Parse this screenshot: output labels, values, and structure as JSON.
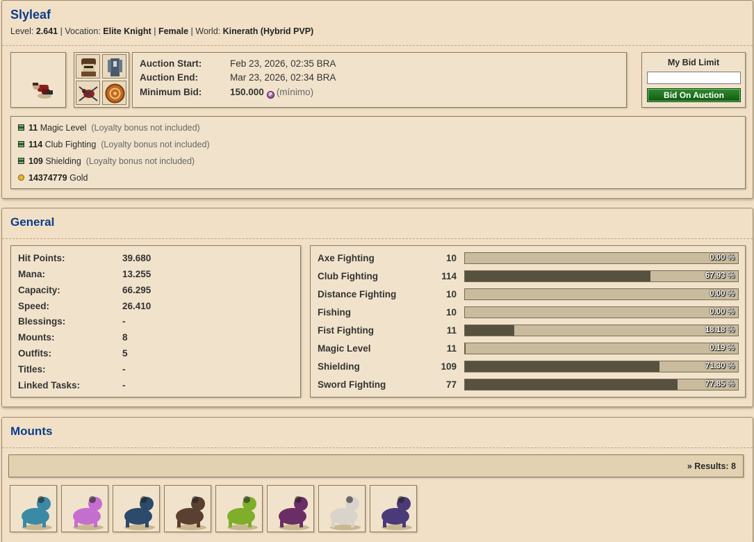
{
  "character": {
    "name": "Slyleaf",
    "level_label": "Level:",
    "level": "2.641",
    "vocation_label": "Vocation:",
    "vocation": "Elite Knight",
    "sex": "Female",
    "world_label": "World:",
    "world": "Kinerath (Hybrid PVP)",
    "sep": "|"
  },
  "auction": {
    "start_label": "Auction Start:",
    "start": "Feb 23, 2026, 02:35 BRA",
    "end_label": "Auction End:",
    "end": "Mar 23, 2026, 02:34 BRA",
    "min_bid_label": "Minimum Bid:",
    "min_bid": "150.000",
    "coin_glyph": "P",
    "min_bid_note": "(mínimo)"
  },
  "bid": {
    "title": "My Bid Limit",
    "input_value": "",
    "button_label": "Bid On Auction"
  },
  "bonuses": [
    {
      "value": "11",
      "name": "Magic Level",
      "note": "(Loyalty bonus not included)",
      "icon": "skill-icon"
    },
    {
      "value": "114",
      "name": "Club Fighting",
      "note": "(Loyalty bonus not included)",
      "icon": "skill-icon"
    },
    {
      "value": "109",
      "name": "Shielding",
      "note": "(Loyalty bonus not included)",
      "icon": "skill-icon"
    },
    {
      "value": "14374779",
      "name": "Gold",
      "note": "",
      "icon": "gold-icon"
    }
  ],
  "general": {
    "title": "General",
    "stats": [
      {
        "label": "Hit Points:",
        "value": "39.680"
      },
      {
        "label": "Mana:",
        "value": "13.255"
      },
      {
        "label": "Capacity:",
        "value": "66.295"
      },
      {
        "label": "Speed:",
        "value": "26.410"
      },
      {
        "label": "Blessings:",
        "value": "-"
      },
      {
        "label": "Mounts:",
        "value": "8"
      },
      {
        "label": "Outfits:",
        "value": "5"
      },
      {
        "label": "Titles:",
        "value": "-"
      },
      {
        "label": "Linked Tasks:",
        "value": "-"
      }
    ],
    "skills": [
      {
        "name": "Axe Fighting",
        "level": "10",
        "percent_label": "0.00 %",
        "progress": 0.0
      },
      {
        "name": "Club Fighting",
        "level": "114",
        "percent_label": "67.93 %",
        "progress": 67.93
      },
      {
        "name": "Distance Fighting",
        "level": "10",
        "percent_label": "0.00 %",
        "progress": 0.0
      },
      {
        "name": "Fishing",
        "level": "10",
        "percent_label": "0.00 %",
        "progress": 0.0
      },
      {
        "name": "Fist Fighting",
        "level": "11",
        "percent_label": "18.18 %",
        "progress": 18.18
      },
      {
        "name": "Magic Level",
        "level": "11",
        "percent_label": "0.19 %",
        "progress": 0.19
      },
      {
        "name": "Shielding",
        "level": "109",
        "percent_label": "71.30 %",
        "progress": 71.3
      },
      {
        "name": "Sword Fighting",
        "level": "77",
        "percent_label": "77.85 %",
        "progress": 77.85
      }
    ]
  },
  "mounts": {
    "title": "Mounts",
    "results_label": "» Results: 8",
    "items": [
      {
        "icon": "blue-beast-mount-icon",
        "color": "#3a8aa6"
      },
      {
        "icon": "pink-spirit-mount-icon",
        "color": "#c46fd0"
      },
      {
        "icon": "beetle-mount-icon",
        "color": "#2c4a6b"
      },
      {
        "icon": "armored-bear-mount-icon",
        "color": "#5a4030"
      },
      {
        "icon": "scorpion-mount-icon",
        "color": "#7fae2a"
      },
      {
        "icon": "dark-wraith-mount-icon",
        "color": "#6b2d66"
      },
      {
        "icon": "white-wolf-mount-icon",
        "color": "#d8d4cc"
      },
      {
        "icon": "green-scorpion-mount-icon",
        "color": "#4b3a7a"
      }
    ]
  },
  "colors": {
    "title_blue": "#0b3d8c",
    "bar_fill": "#57513f",
    "bar_track": "#c9bc9e",
    "bid_button": "#1a6e1a"
  }
}
